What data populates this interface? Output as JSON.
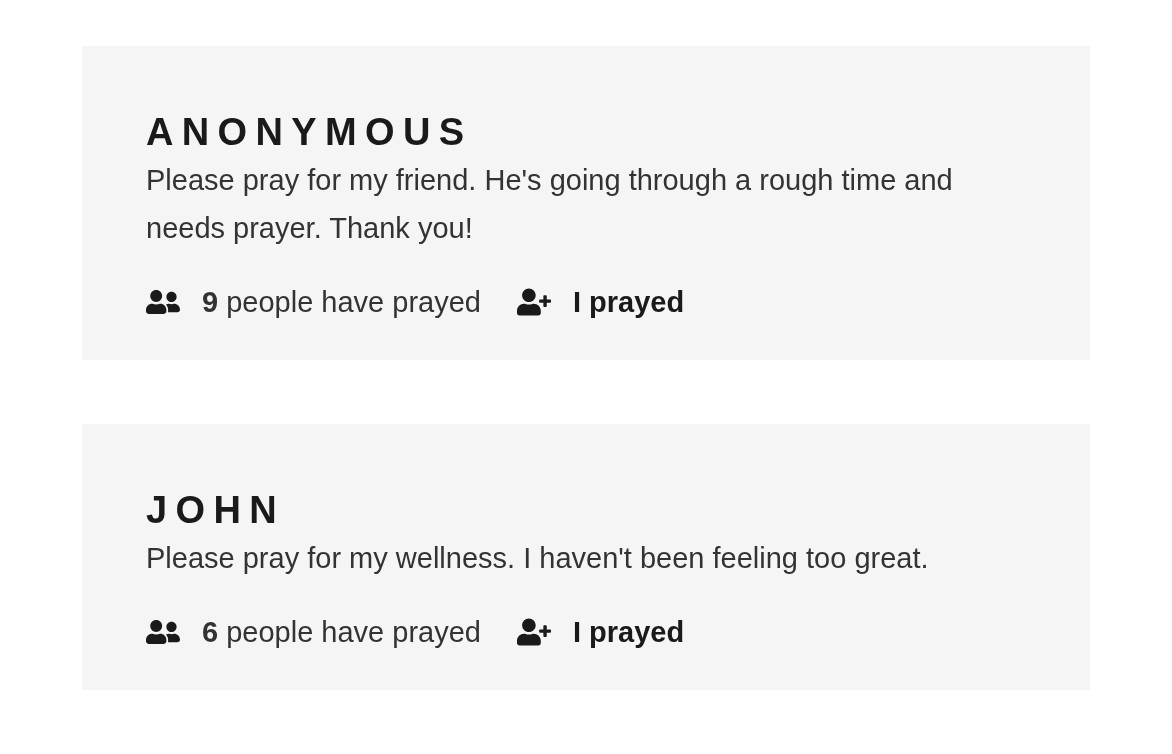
{
  "requests": [
    {
      "name": "ANONYMOUS",
      "message": "Please pray for my friend. He's going through a rough time and needs prayer. Thank you!",
      "prayed_count": "**9** people have prayed",
      "action": "I prayed"
    },
    {
      "name": "JOHN",
      "message": "Please pray for my wellness. I haven't been feeling too great.",
      "prayed_count": "**6** people have prayed",
      "action": "I prayed"
    }
  ]
}
